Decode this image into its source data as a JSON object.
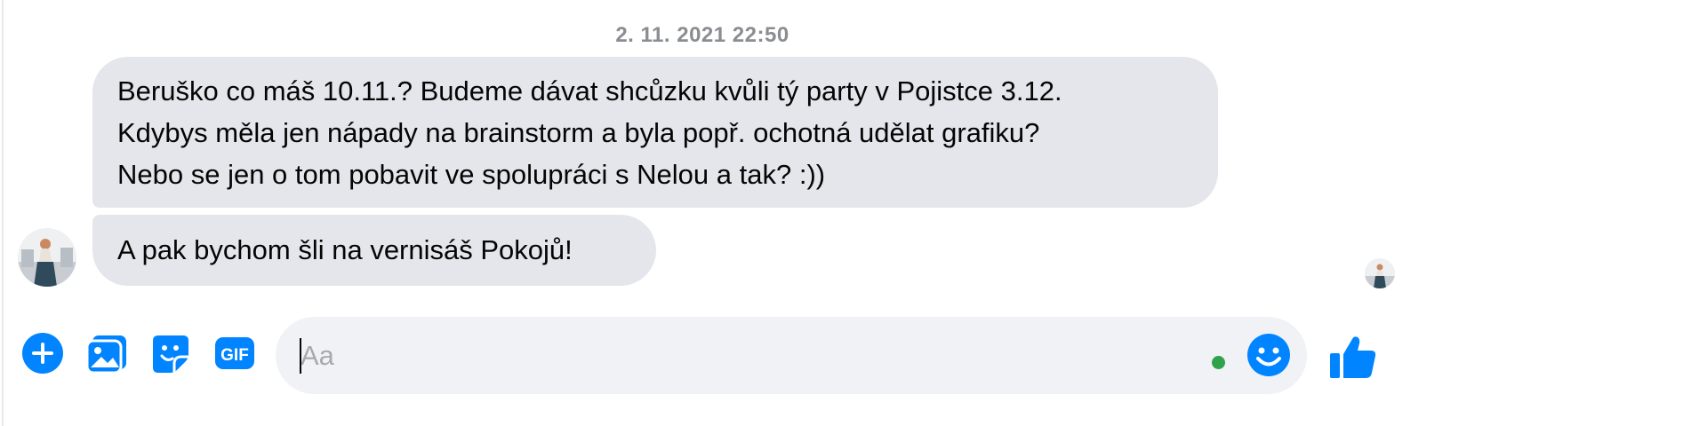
{
  "conversation": {
    "timestamp": "2. 11. 2021 22:50",
    "messages": [
      {
        "lines": [
          "Beruško co máš 10.11.? Budeme dávat shcůzku kvůli tý party v Pojistce 3.12.",
          "Kdybys měla jen nápady na brainstorm a byla popř. ochotná udělat grafiku?",
          "Nebo se jen o tom pobavit ve spolupráci s Nelou a tak? :))"
        ]
      },
      {
        "lines": [
          "A pak bychom šli na vernisáš Pokojů!"
        ]
      }
    ]
  },
  "composer": {
    "placeholder": "Aa",
    "value": "",
    "icons": [
      "plus-circle-icon",
      "photo-gallery-icon",
      "sticker-icon",
      "gif-icon",
      "emoji-icon",
      "thumbs-up-icon"
    ],
    "accent_color": "#0084ff",
    "online_color": "#31a24c"
  },
  "colors": {
    "bubble_bg": "#e4e6eb",
    "input_bg": "#f0f2f5",
    "timestamp": "#8a8d91"
  }
}
